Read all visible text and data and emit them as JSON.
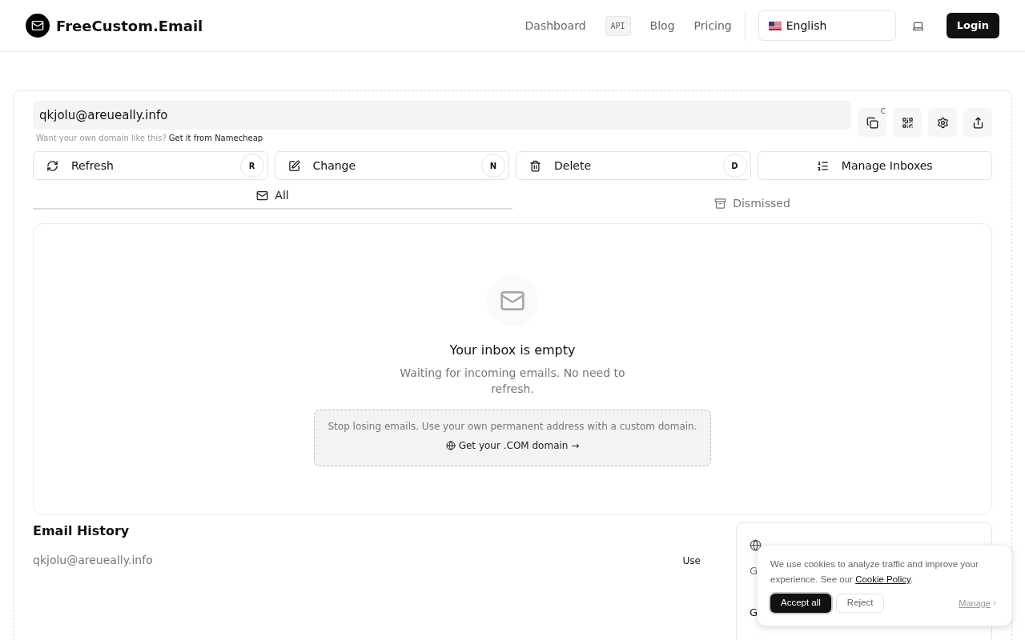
{
  "header": {
    "logo_text": "FreeCustom.Email",
    "nav": [
      {
        "kind": "link",
        "label": "Dashboard"
      },
      {
        "kind": "badge",
        "label": "API"
      },
      {
        "kind": "link",
        "label": "Blog"
      },
      {
        "kind": "link",
        "label": "Pricing"
      }
    ],
    "language": "English",
    "login": "Login"
  },
  "inbox": {
    "address": "qkjolu@areueally.info",
    "hint": {
      "text": "Want your own domain like this?",
      "link": "Get it from Namecheap"
    },
    "icon_buttons": [
      {
        "kind": "copy",
        "shortcut": "C"
      },
      {
        "kind": "qr"
      },
      {
        "kind": "settings"
      },
      {
        "kind": "share"
      }
    ],
    "actions": [
      {
        "kind": "refresh",
        "label": "Refresh",
        "shortcut": "R"
      },
      {
        "kind": "change",
        "label": "Change",
        "shortcut": "N"
      },
      {
        "kind": "delete",
        "label": "Delete",
        "shortcut": "D"
      },
      {
        "kind": "manage",
        "label": "Manage Inboxes"
      }
    ],
    "tabs": [
      {
        "kind": "all",
        "label": "All",
        "selected": true
      },
      {
        "kind": "dismissed",
        "label": "Dismissed",
        "selected": false
      }
    ],
    "empty": {
      "title": "Your inbox is empty",
      "text": "Waiting for incoming emails. No need to refresh.",
      "promo": {
        "text": "Stop losing emails. Use your own permanent address with a custom domain.",
        "link": "Get your .COM domain →"
      }
    }
  },
  "history": {
    "title": "Email History",
    "rows": [
      {
        "address": "qkjolu@areueally.info",
        "action": "Use"
      }
    ]
  },
  "side_card": {
    "lines": [
      "G",
      "G"
    ]
  },
  "cookie": {
    "text": "We use cookies to analyze traffic and improve your experience. See our ",
    "link": "Cookie Policy",
    "text_end": ".",
    "accept": "Accept all",
    "reject": "Reject",
    "manage": "Manage"
  }
}
